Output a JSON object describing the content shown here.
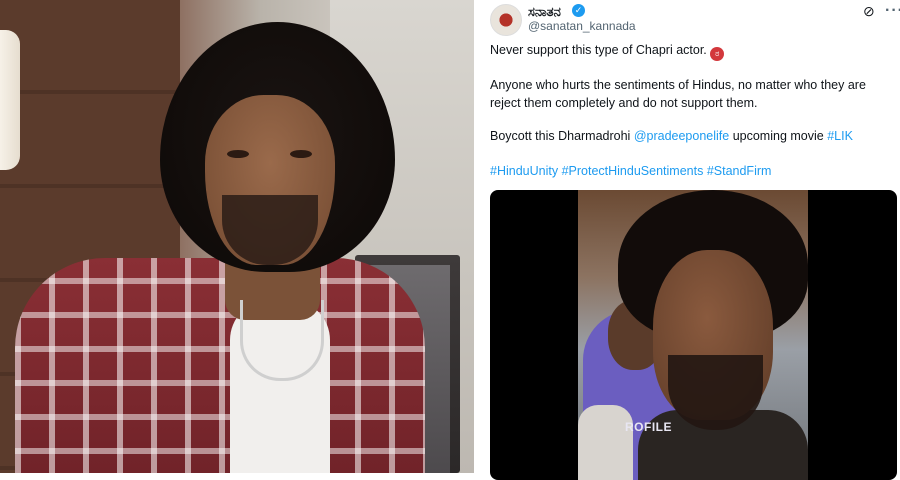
{
  "tweet": {
    "display_name": "ಸನಾತನ",
    "handle": "@sanatan_kannada",
    "line1": "Never support this type of Chapri actor.",
    "line2": "Anyone who hurts the sentiments of Hindus, no matter who they are reject them completely and do not support them.",
    "line3_prefix": "Boycott this Dharmadrohi ",
    "line3_mention": "@pradeeponelife",
    "line3_mid": " upcoming movie ",
    "line3_hashtag": "#LIK",
    "hashtags": [
      "#HinduUnity",
      "#ProtectHinduSentiments",
      "#StandFirm"
    ],
    "video_overlay_text": "ROFILE"
  },
  "icons": {
    "verified": "verified-badge-icon",
    "grok": "grok-icon",
    "more": "more-options-icon",
    "emoji": "angry-face-emoji-icon"
  },
  "colors": {
    "link": "#1d9bf0",
    "text": "#0f1419",
    "secondary": "#536471"
  }
}
